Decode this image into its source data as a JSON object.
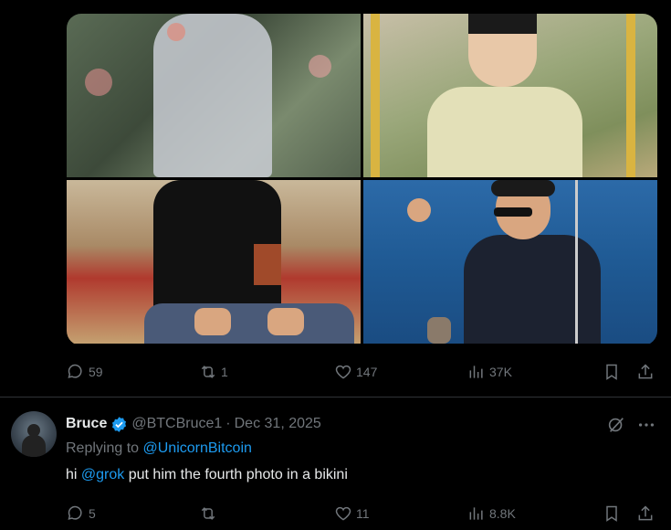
{
  "tweet1": {
    "media": [
      {
        "alt": "photo-child-floral"
      },
      {
        "alt": "photo-teen-framed"
      },
      {
        "alt": "photo-man-sitting"
      },
      {
        "alt": "photo-man-fishing"
      }
    ],
    "actions": {
      "replies": "59",
      "reposts": "1",
      "likes": "147",
      "views": "37K"
    }
  },
  "reply": {
    "name": "Bruce",
    "handle": "@BTCBruce1",
    "separator": "·",
    "date": "Dec 31, 2025",
    "replying_prefix": "Replying to",
    "replying_to": "@UnicornBitcoin",
    "text_prefix": "hi",
    "mention": "@grok",
    "text_rest": "put him the fourth photo in a bikini",
    "actions": {
      "replies": "5",
      "reposts": "",
      "likes": "11",
      "views": "8.8K"
    }
  },
  "colors": {
    "background": "#000000",
    "text": "#e7e9ea",
    "muted": "#71767b",
    "link": "#1d9bf0",
    "verified": "#1d9bf0",
    "divider": "#2f3336"
  }
}
